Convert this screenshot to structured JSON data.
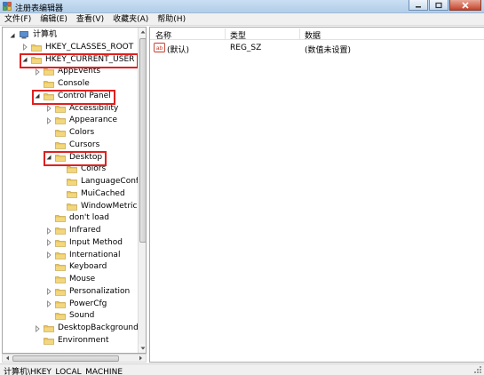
{
  "window": {
    "title": "注册表编辑器"
  },
  "menu": [
    "文件(F)",
    "编辑(E)",
    "查看(V)",
    "收藏夹(A)",
    "帮助(H)"
  ],
  "colors": {
    "highlight": "#e02020",
    "folder": "#e8c45a"
  },
  "tree": [
    {
      "label": "计算机",
      "level": 0,
      "toggle": "expanded",
      "icon": "computer-icon"
    },
    {
      "label": "HKEY_CLASSES_ROOT",
      "level": 1,
      "toggle": "collapsed",
      "icon": "folder-icon"
    },
    {
      "label": "HKEY_CURRENT_USER",
      "level": 1,
      "toggle": "expanded",
      "icon": "folder-icon",
      "highlighted": true
    },
    {
      "label": "AppEvents",
      "level": 2,
      "toggle": "collapsed",
      "icon": "folder-icon"
    },
    {
      "label": "Console",
      "level": 2,
      "toggle": "none",
      "icon": "folder-icon"
    },
    {
      "label": "Control Panel",
      "level": 2,
      "toggle": "expanded",
      "icon": "folder-icon",
      "highlighted": true
    },
    {
      "label": "Accessibility",
      "level": 3,
      "toggle": "collapsed",
      "icon": "folder-icon"
    },
    {
      "label": "Appearance",
      "level": 3,
      "toggle": "collapsed",
      "icon": "folder-icon"
    },
    {
      "label": "Colors",
      "level": 3,
      "toggle": "none",
      "icon": "folder-icon"
    },
    {
      "label": "Cursors",
      "level": 3,
      "toggle": "none",
      "icon": "folder-icon"
    },
    {
      "label": "Desktop",
      "level": 3,
      "toggle": "expanded",
      "icon": "folder-icon",
      "highlighted": true
    },
    {
      "label": "Colors",
      "level": 4,
      "toggle": "none",
      "icon": "folder-icon"
    },
    {
      "label": "LanguageConfig",
      "level": 4,
      "toggle": "none",
      "icon": "folder-icon"
    },
    {
      "label": "MuiCached",
      "level": 4,
      "toggle": "none",
      "icon": "folder-icon"
    },
    {
      "label": "WindowMetrics",
      "level": 4,
      "toggle": "none",
      "icon": "folder-icon"
    },
    {
      "label": "don't load",
      "level": 3,
      "toggle": "none",
      "icon": "folder-icon"
    },
    {
      "label": "Infrared",
      "level": 3,
      "toggle": "collapsed",
      "icon": "folder-icon"
    },
    {
      "label": "Input Method",
      "level": 3,
      "toggle": "collapsed",
      "icon": "folder-icon"
    },
    {
      "label": "International",
      "level": 3,
      "toggle": "collapsed",
      "icon": "folder-icon"
    },
    {
      "label": "Keyboard",
      "level": 3,
      "toggle": "none",
      "icon": "folder-icon"
    },
    {
      "label": "Mouse",
      "level": 3,
      "toggle": "none",
      "icon": "folder-icon"
    },
    {
      "label": "Personalization",
      "level": 3,
      "toggle": "collapsed",
      "icon": "folder-icon"
    },
    {
      "label": "PowerCfg",
      "level": 3,
      "toggle": "collapsed",
      "icon": "folder-icon"
    },
    {
      "label": "Sound",
      "level": 3,
      "toggle": "none",
      "icon": "folder-icon"
    },
    {
      "label": "DesktopBackground",
      "level": 2,
      "toggle": "collapsed",
      "icon": "folder-icon"
    },
    {
      "label": "Environment",
      "level": 2,
      "toggle": "none",
      "icon": "folder-icon"
    }
  ],
  "list": {
    "columns": [
      "名称",
      "类型",
      "数据"
    ],
    "rows": [
      {
        "name": "(默认)",
        "type": "REG_SZ",
        "data": "(数值未设置)",
        "icon": "string-value-icon"
      }
    ]
  },
  "status": "计算机\\HKEY_LOCAL_MACHINE"
}
